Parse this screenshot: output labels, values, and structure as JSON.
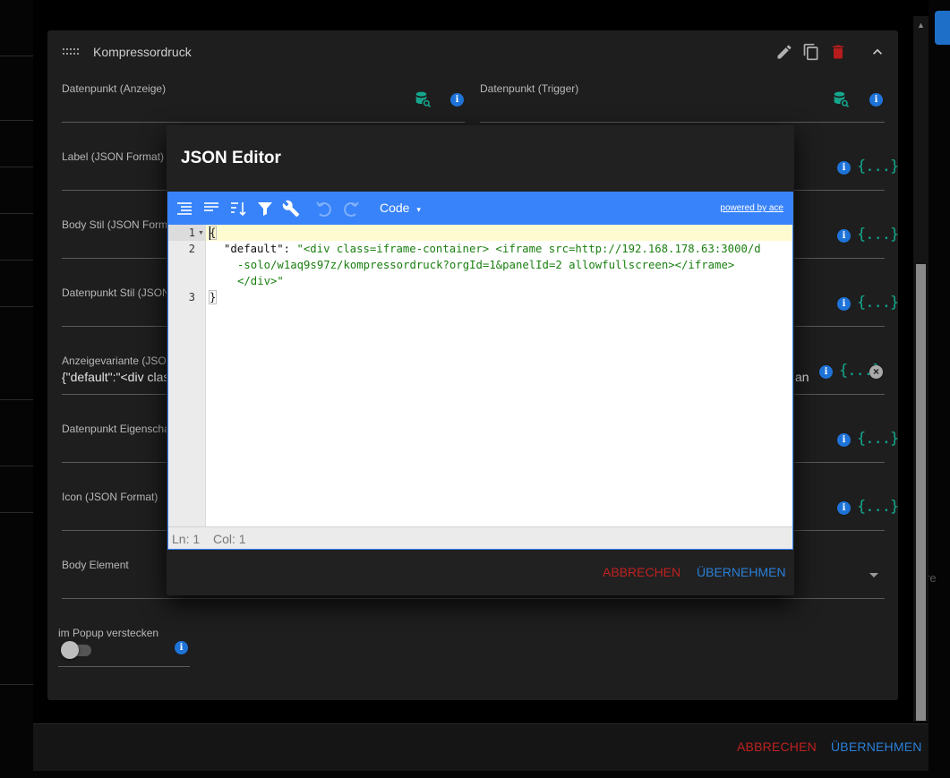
{
  "card": {
    "title": "Kompressordruck"
  },
  "fields": {
    "datapoint_display": "Datenpunkt (Anzeige)",
    "datapoint_trigger": "Datenpunkt (Trigger)",
    "label": "Label (JSON Format)",
    "body_style": "Body Stil (JSON Form",
    "datapoint_style": "Datenpunkt Stil (JSON",
    "display_variant": "Anzeigevariante (JSON",
    "display_variant_value": "{\"default\":\"<div clas",
    "display_variant_value_tail": "an",
    "datapoint_props": "Datenpunkt Eigenscha",
    "icon": "Icon (JSON Format)",
    "body_element": "Body Element",
    "hide_in_popup": "im Popup verstecken",
    "json_icon_text": "{...}",
    "info_text": "i"
  },
  "editor": {
    "title": "JSON Editor",
    "mode": "Code",
    "mode_caret": "▾",
    "powered_by": "powered by ace",
    "line_numbers": [
      "1",
      "2",
      "3"
    ],
    "line1": "{",
    "line2_key": "\"default\"",
    "line2_colon": ": ",
    "line2_str_a": "\"<div class=iframe-container> <iframe src=http://192.168.178.63:3000/d",
    "line2_str_b": "-solo/w1aq9s97z/kompressordruck?orgId=1&panelId=2 allowfullscreen></iframe>",
    "line2_str_c": "</div>\"",
    "line3": "}",
    "status_ln": "Ln: 1",
    "status_col": "Col: 1",
    "cancel": "ABBRECHEN",
    "apply": "ÜBERNEHMEN"
  },
  "dialog_footer": {
    "cancel": "ABBRECHEN",
    "apply": "ÜBERNEHMEN"
  },
  "background": {
    "right_text": "re"
  },
  "colors": {
    "accent_blue": "#3883fa",
    "cancel_red": "#c02020",
    "apply_blue": "#2a7fd8",
    "json_icon_teal": "#15a88e",
    "delete_red": "#b71c1c"
  }
}
